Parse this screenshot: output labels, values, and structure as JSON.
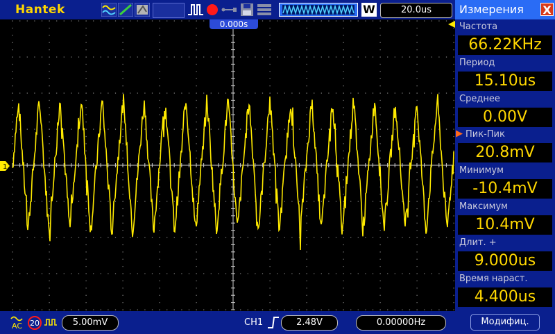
{
  "topbar": {
    "brand": "Hantek",
    "timebase": "20.0us",
    "w_badge": "W"
  },
  "trigger_position": "0.000s",
  "channel_marker": "1",
  "bottombar": {
    "ch1_scale": "5.00mV",
    "bw_limit": "20",
    "trigger_source": "CH1",
    "trigger_level": "2.48V",
    "frequency_counter": "0.00000Hz"
  },
  "measurements_panel": {
    "title": "Измерения",
    "close": "X",
    "items": [
      {
        "label": "Частота",
        "value": "66.22KHz"
      },
      {
        "label": "Период",
        "value": "15.10us"
      },
      {
        "label": "Среднее",
        "value": "0.00V"
      },
      {
        "label": "Пик-Пик",
        "value": "20.8mV"
      },
      {
        "label": "Минимум",
        "value": "-10.4mV"
      },
      {
        "label": "Максимум",
        "value": "10.4mV"
      },
      {
        "label": "Длит. +",
        "value": "9.000us"
      },
      {
        "label": "Время нараст.",
        "value": "4.400us"
      }
    ],
    "selected_index": 3,
    "modify_button": "Модифиц."
  },
  "colors": {
    "trace": "#ffea00",
    "bar": "#0a1f8e",
    "panel_header": "#2a6cf5",
    "grid": "#8a8a8a"
  }
}
